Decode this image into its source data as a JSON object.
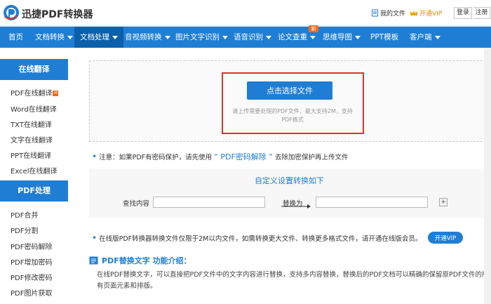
{
  "header": {
    "brand": "迅捷PDF转换器",
    "my_files": "我的文件",
    "vip": "开通VIP",
    "login": "登录",
    "register": "注册"
  },
  "nav": {
    "items": [
      {
        "label": "首页"
      },
      {
        "label": "文档转换"
      },
      {
        "label": "文档处理"
      },
      {
        "label": "音视频转换"
      },
      {
        "label": "图片文字识别"
      },
      {
        "label": "语音识别"
      },
      {
        "label": "论文查重"
      },
      {
        "label": "思维导图"
      },
      {
        "label": "PPT模板"
      },
      {
        "label": "客户端"
      }
    ],
    "new_badge": "新"
  },
  "sidebar": {
    "section1": {
      "title": "在线翻译",
      "items": [
        "PDF在线翻译",
        "Word在线翻译",
        "TXT在线翻译",
        "文字在线翻译",
        "PPT在线翻译",
        "Excel在线翻译"
      ]
    },
    "section2": {
      "title": "PDF处理",
      "items": [
        "PDF合并",
        "PDF分割",
        "PDF密码解除",
        "PDF增加密码",
        "PDF修改密码",
        "PDF图片获取"
      ]
    }
  },
  "upload": {
    "button": "点击选择文件",
    "hint": "请上传需要处理的PDF文件，最大支持2M，支持PDF格式"
  },
  "note1": {
    "prefix": "注意：如果PDF有密码保护，请先使用",
    "link": "“ PDF密码解除 ”",
    "suffix": "去除加密保护再上传文件"
  },
  "settings": {
    "title": "自定义设置转换如下",
    "find_label": "查找内容",
    "replace_label": "替换为",
    "find_value": "",
    "replace_value": "",
    "add": "+"
  },
  "note2": {
    "text": "在线版PDF转换器转换文件仅限于2M以内文件，如需转换更大文件、转换更多格式文件，请开通在线版会员。",
    "vip_button": "开通VIP"
  },
  "intro": {
    "title": "PDF替换文字 功能介绍：",
    "text": "在线PDF替换文字，可以直接把PDF文件中的文字内容进行替换，支持多内容替换，替换后的PDF文档可以精确的保留原PDF文件的所有页面元素和排版。"
  },
  "colors": {
    "primary": "#1f7ed3",
    "nav_active": "#0c5faa",
    "highlight": "#e03131",
    "badge": "#f26b1d"
  }
}
